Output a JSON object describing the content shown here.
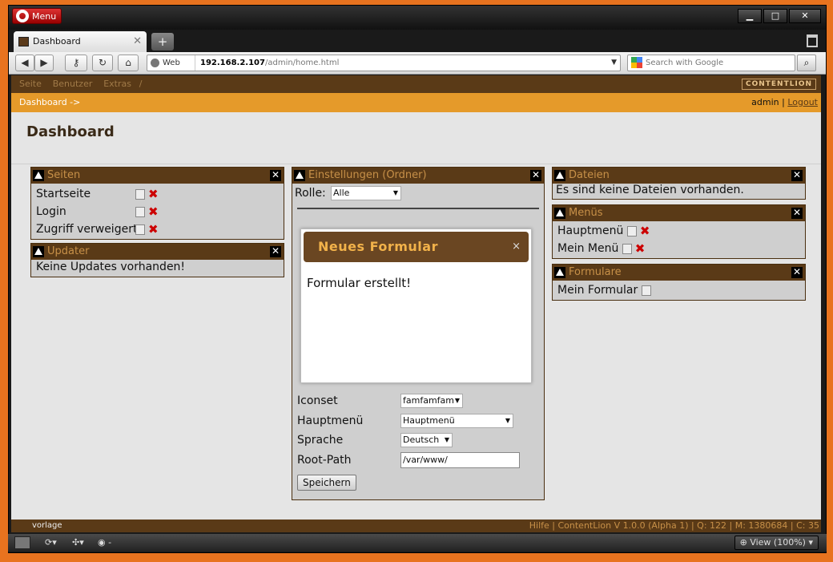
{
  "browser": {
    "menu_label": "Menu",
    "tab_title": "Dashboard",
    "address": {
      "web_label": "Web",
      "host": "192.168.2.107",
      "path": "/admin/home.html"
    },
    "search_placeholder": "Search with Google",
    "zoom_label": "View (100%)"
  },
  "topnav": {
    "items": [
      "Seite",
      "Benutzer",
      "Extras"
    ],
    "trailing": "/",
    "logo": "CONTENTLION"
  },
  "crumb": {
    "path": "Dashboard ->",
    "user": "admin",
    "sep": "|",
    "logout": "Logout"
  },
  "page_title": "Dashboard",
  "seiten": {
    "title": "Seiten",
    "items": [
      {
        "label": "Startseite"
      },
      {
        "label": "Login"
      },
      {
        "label": "Zugriff verweigert"
      }
    ]
  },
  "updater": {
    "title": "Updater",
    "message": "Keine Updates vorhanden!"
  },
  "einstellungen": {
    "title": "Einstellungen (Ordner)",
    "rolle_label": "Rolle:",
    "rolle_value": "Alle",
    "rows": [
      {
        "label": "Iconset",
        "value": "famfamfam"
      },
      {
        "label": "Hauptmenü",
        "value": "Hauptmenü"
      },
      {
        "label": "Sprache",
        "value": "Deutsch"
      },
      {
        "label": "Root-Path",
        "value": "/var/www/"
      }
    ],
    "save_label": "Speichern"
  },
  "dateien": {
    "title": "Dateien",
    "message": "Es sind keine Dateien vorhanden."
  },
  "menus": {
    "title": "Menüs",
    "items": [
      {
        "label": "Hauptmenü"
      },
      {
        "label": "Mein Menü"
      }
    ]
  },
  "formulare": {
    "title": "Formulare",
    "items": [
      {
        "label": "Mein Formular"
      }
    ]
  },
  "modal": {
    "title": "Neues Formular",
    "close": "×",
    "message": "Formular erstellt!"
  },
  "footer": {
    "left": "vorlage",
    "right": "Hilfe | ContentLion V 1.0.0 (Alpha 1) | Q: 122 | M: 1380684 | C: 35"
  }
}
